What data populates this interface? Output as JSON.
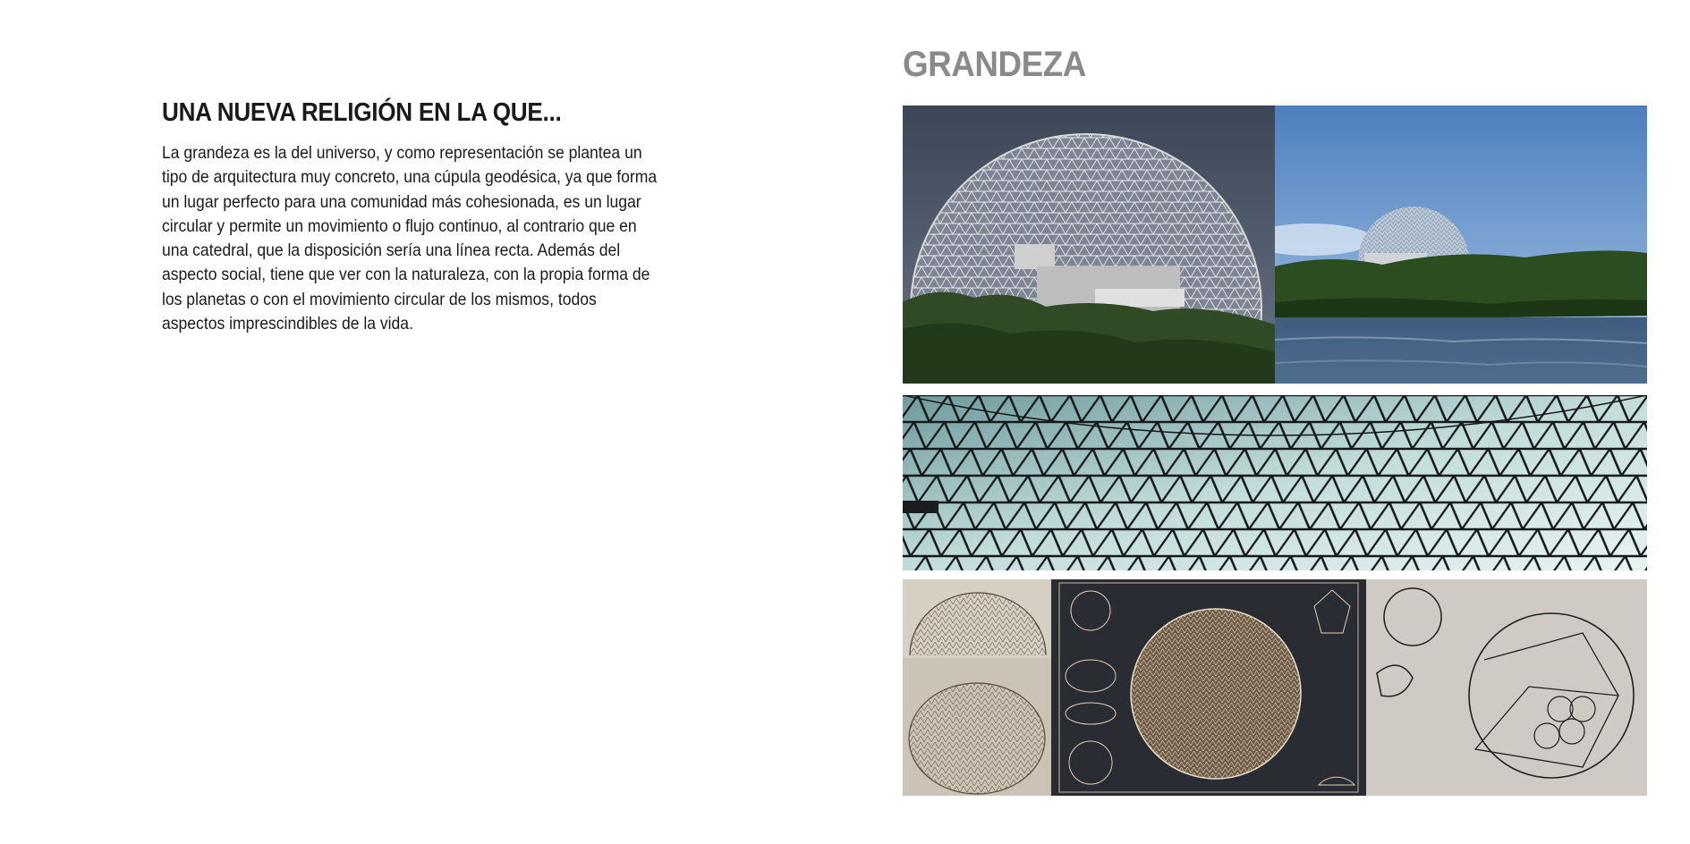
{
  "left_page": {
    "heading": "UNA NUEVA RELIGIÓN EN LA QUE...",
    "paragraph": "La grandeza es la del universo, y como representación se plantea un tipo de arquitectura muy concreto, una cúpula geodésica, ya que forma un lugar perfecto para una comunidad más cohesionada, es un lugar circular y permite un movimiento o flujo continuo, al contrario que en una catedral, que la disposición sería una línea recta. Además del aspecto social, tiene que ver con la naturaleza, con la propia forma de los planetas o con el movimiento circular de los mismos, todos aspectos imprescindibles de la vida."
  },
  "right_page": {
    "title": "GRANDEZA"
  },
  "colors": {
    "heading": "#1a1a1a",
    "section_title": "#8a8a8a",
    "page_background": "#ffffff"
  }
}
